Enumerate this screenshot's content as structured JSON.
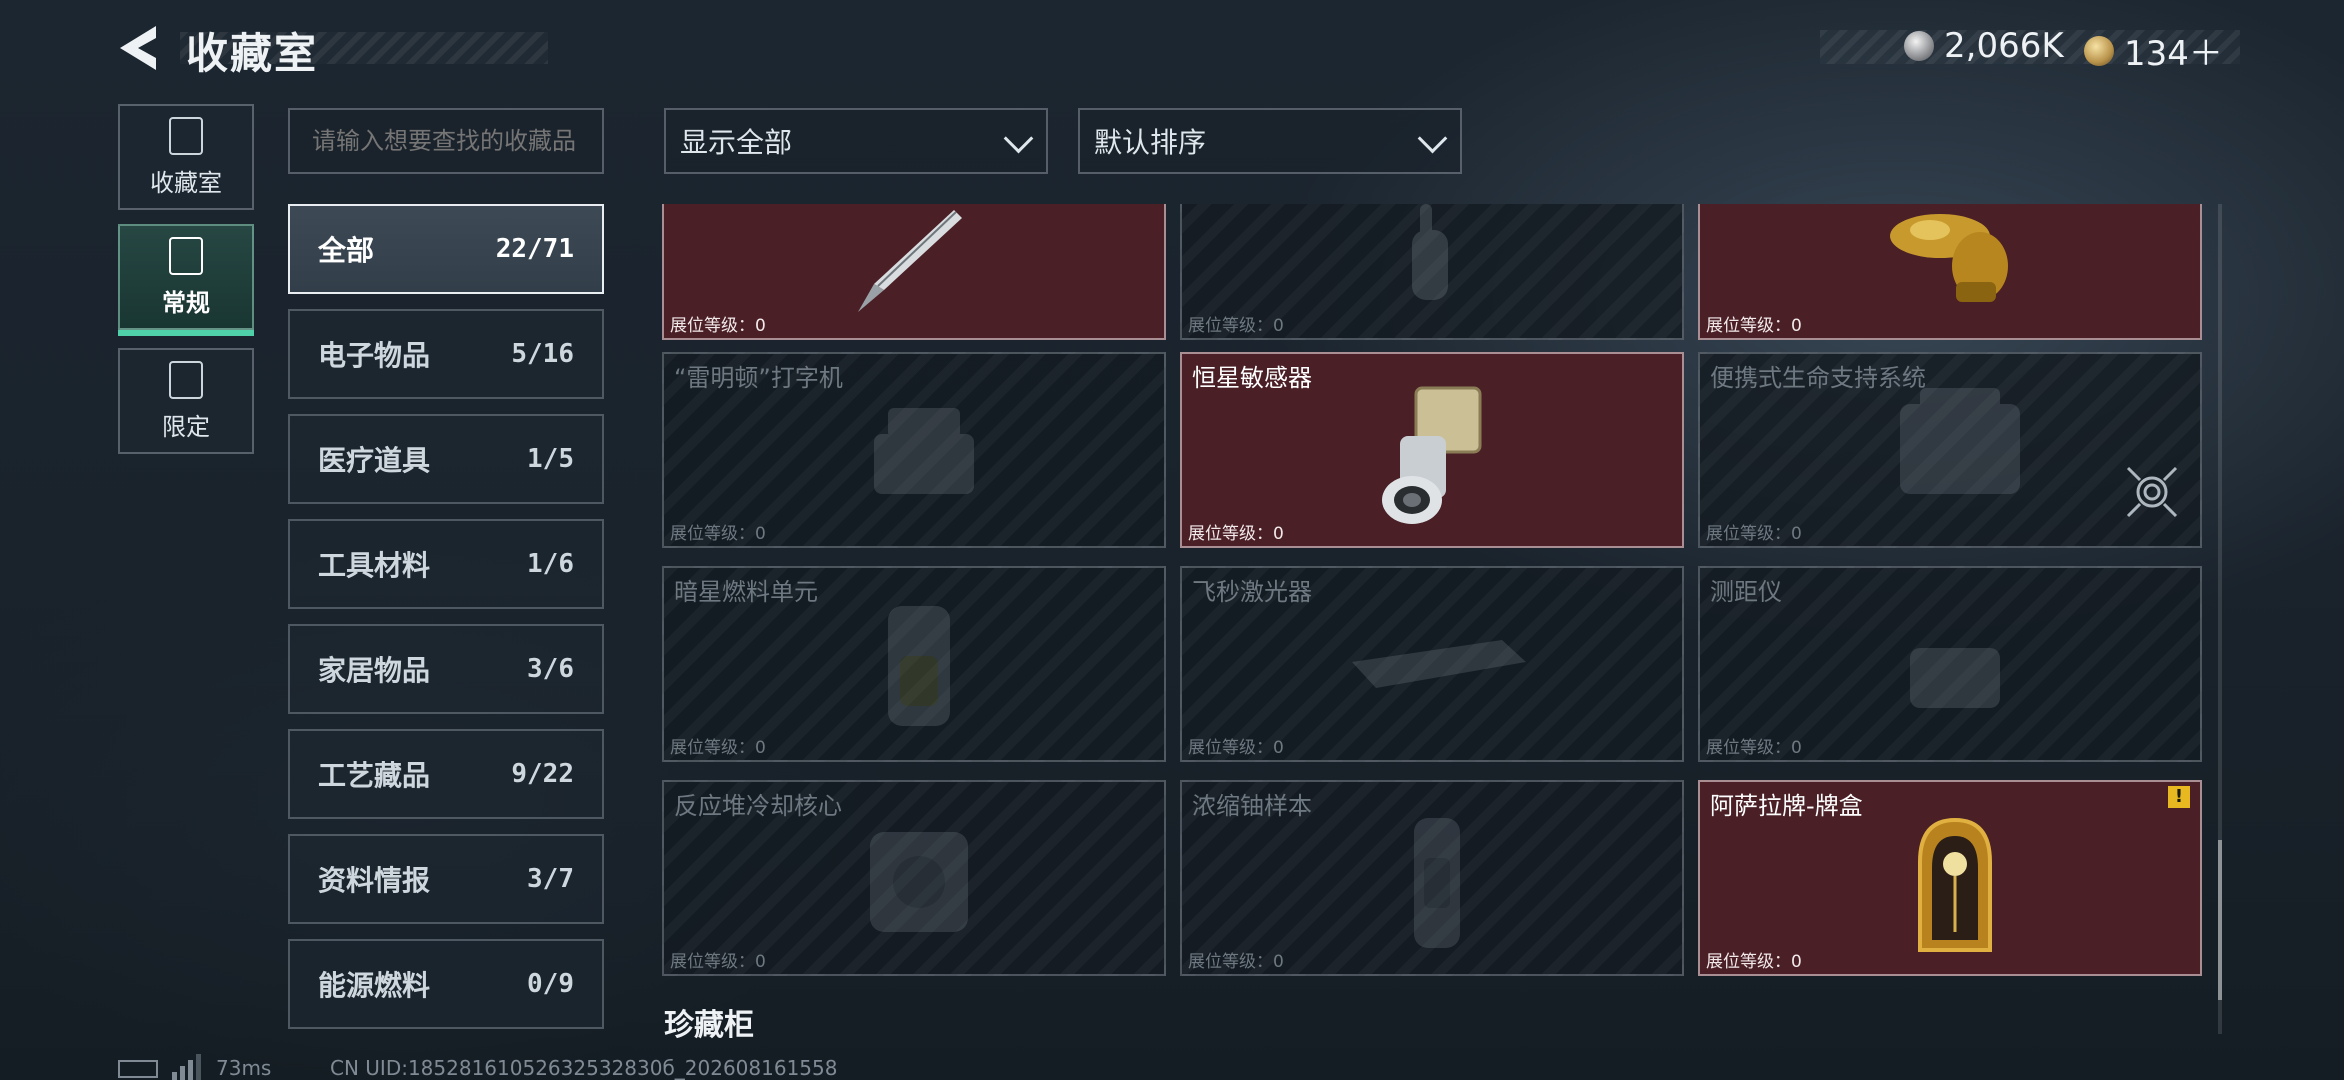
{
  "header": {
    "title": "收藏室",
    "currency_silver": "2,066K",
    "currency_gold": "134＋"
  },
  "side_tabs": [
    {
      "label": "收藏室",
      "icon": "jar-icon",
      "active": false
    },
    {
      "label": "常规",
      "icon": "picture-icon",
      "active": true
    },
    {
      "label": "限定",
      "icon": "landscape-icon",
      "active": false
    }
  ],
  "search": {
    "placeholder": "请输入想要查找的收藏品"
  },
  "categories": [
    {
      "label": "全部",
      "count": "22/71",
      "active": true
    },
    {
      "label": "电子物品",
      "count": "5/16"
    },
    {
      "label": "医疗道具",
      "count": "1/5"
    },
    {
      "label": "工具材料",
      "count": "1/6"
    },
    {
      "label": "家居物品",
      "count": "3/6"
    },
    {
      "label": "工艺藏品",
      "count": "9/22"
    },
    {
      "label": "资料情报",
      "count": "3/7"
    },
    {
      "label": "能源燃料",
      "count": "0/9"
    }
  ],
  "filters": {
    "show": "显示全部",
    "sort": "默认排序"
  },
  "level_label": "展位等级：",
  "cards": [
    {
      "name": "",
      "level": "0",
      "owned": true,
      "icon": "fountain-pen-icon"
    },
    {
      "name": "",
      "level": "0",
      "owned": false,
      "icon": "hand-figure-icon"
    },
    {
      "name": "",
      "level": "0",
      "owned": true,
      "icon": "golden-horse-icon"
    },
    {
      "name": "“雷明顿”打字机",
      "level": "0",
      "owned": false,
      "icon": "typewriter-icon"
    },
    {
      "name": "恒星敏感器",
      "level": "0",
      "owned": true,
      "icon": "star-sensor-icon"
    },
    {
      "name": "便携式生命支持系统",
      "level": "0",
      "owned": false,
      "icon": "life-support-icon",
      "has_target": true
    },
    {
      "name": "暗星燃料单元",
      "level": "0",
      "owned": false,
      "icon": "fuel-cell-icon"
    },
    {
      "name": "飞秒激光器",
      "level": "0",
      "owned": false,
      "icon": "laser-icon"
    },
    {
      "name": "测距仪",
      "level": "0",
      "owned": false,
      "icon": "rangefinder-icon"
    },
    {
      "name": "反应堆冷却核心",
      "level": "0",
      "owned": false,
      "icon": "reactor-core-icon"
    },
    {
      "name": "浓缩铀样本",
      "level": "0",
      "owned": false,
      "icon": "uranium-sample-icon"
    },
    {
      "name": "阿萨拉牌-牌盒",
      "level": "0",
      "owned": true,
      "icon": "card-box-icon",
      "alert": "!"
    }
  ],
  "section_title": "珍藏柜",
  "footer": {
    "ping": "73ms",
    "uid": "CN UID:18528161052632532830б_202608161558"
  },
  "colors": {
    "owned_card": "#4a1f25",
    "accent_green": "#4fd0a8",
    "alert_yellow": "#e8b820"
  }
}
